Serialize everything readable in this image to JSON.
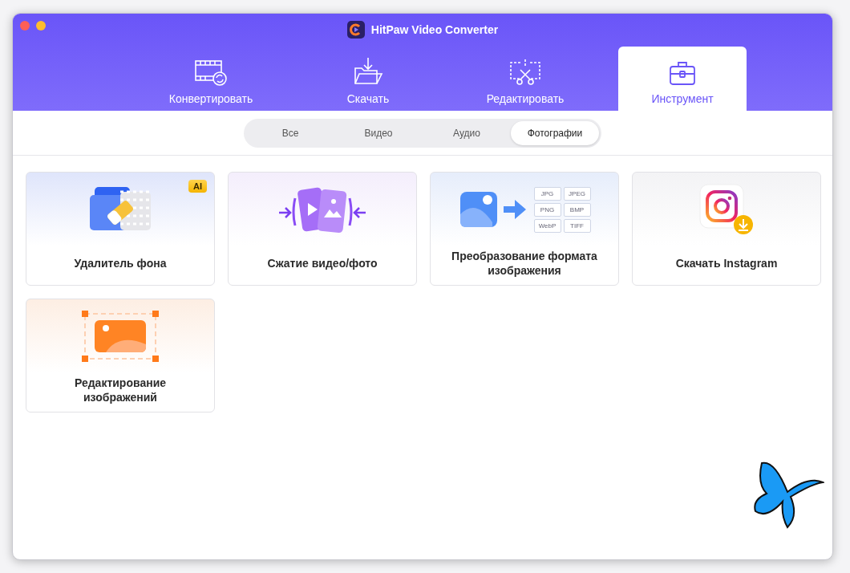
{
  "window": {
    "title": "HitPaw Video Converter"
  },
  "tabs": [
    {
      "kind": "convert",
      "label": "Конвертировать",
      "selected": false
    },
    {
      "kind": "download",
      "label": "Скачать",
      "selected": false
    },
    {
      "kind": "edit",
      "label": "Редактировать",
      "selected": false
    },
    {
      "kind": "toolbox",
      "label": "Инструмент",
      "selected": true
    }
  ],
  "filters": [
    {
      "label": "Все",
      "selected": false
    },
    {
      "label": "Видео",
      "selected": false
    },
    {
      "label": "Аудио",
      "selected": false
    },
    {
      "label": "Фотографии",
      "selected": true
    }
  ],
  "tools": [
    {
      "kind": "background-remover",
      "label": "Удалитель фона",
      "badge": "AI"
    },
    {
      "kind": "compress",
      "label": "Сжатие видео/фото"
    },
    {
      "kind": "image-convert",
      "label": "Преобразование формата изображения",
      "formats": [
        "JPG",
        "JPEG",
        "PNG",
        "BMP",
        "WebP",
        "TIFF"
      ]
    },
    {
      "kind": "instagram",
      "label": "Скачать Instagram"
    },
    {
      "kind": "image-edit",
      "label": "Редактирование изображений"
    }
  ]
}
